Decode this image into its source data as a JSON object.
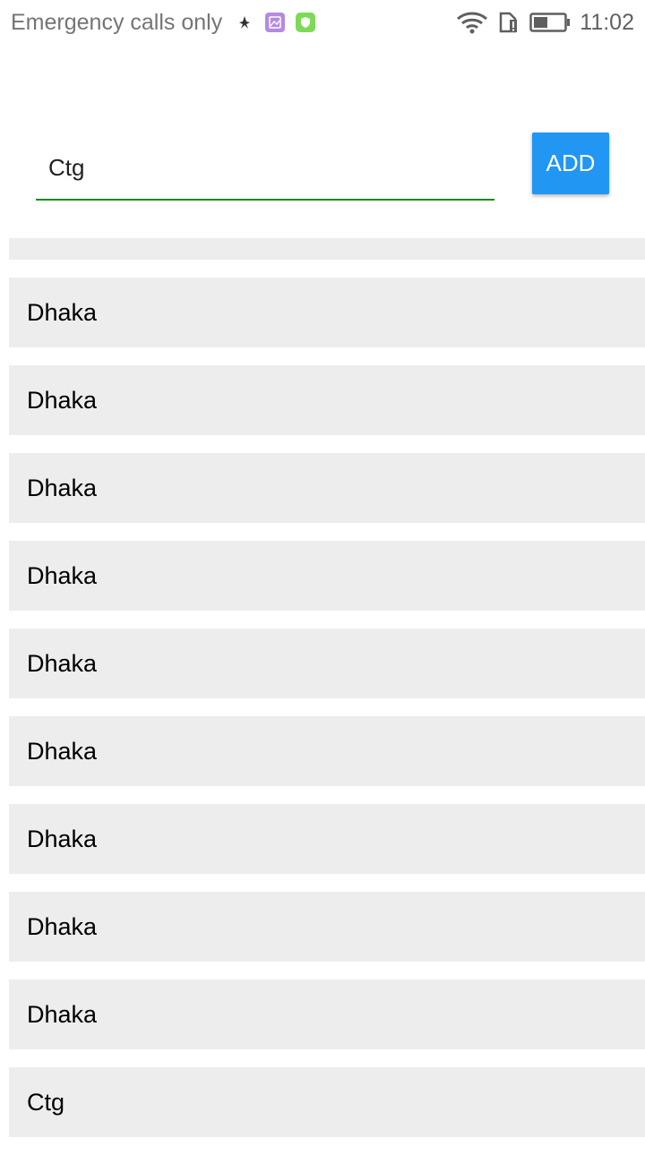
{
  "status_bar": {
    "carrier": "Emergency calls only",
    "time": "11:02",
    "icons": [
      "bug-icon",
      "image-notification-icon",
      "shield-app-icon",
      "wifi-icon",
      "sim-alert-icon",
      "battery-icon"
    ]
  },
  "input": {
    "value": "Ctg",
    "underline_color": "#1b8a1b"
  },
  "add_button": {
    "label": "ADD",
    "color": "#2196f3"
  },
  "list": {
    "first_item": "",
    "items": [
      "Dhaka",
      "Dhaka",
      "Dhaka",
      "Dhaka",
      "Dhaka",
      "Dhaka",
      "Dhaka",
      "Dhaka",
      "Dhaka",
      "Ctg"
    ]
  }
}
